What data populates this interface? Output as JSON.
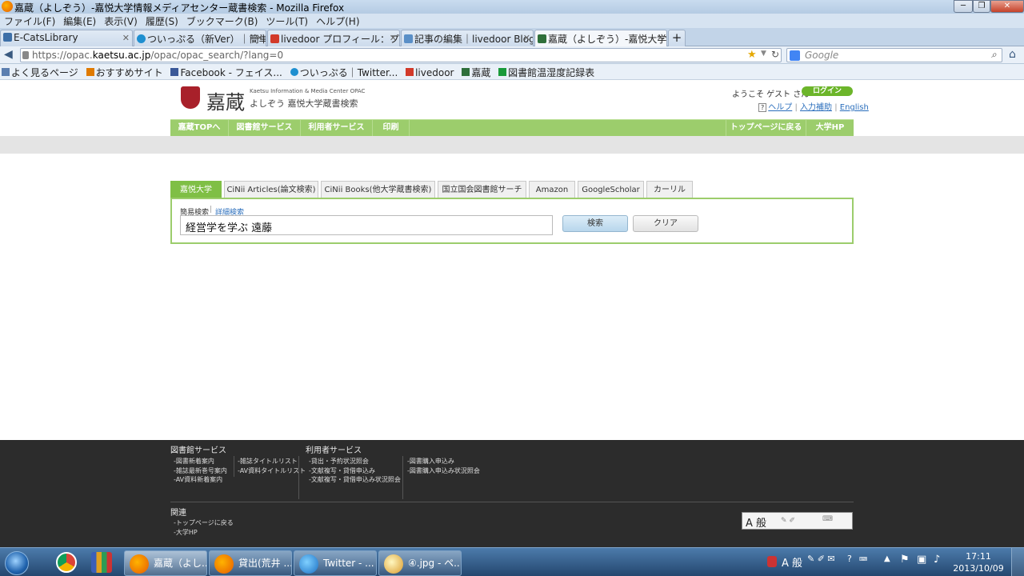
{
  "window": {
    "title": "嘉蔵（よしぞう）-嘉悦大学情報メディアセンター蔵書検索 - Mozilla Firefox",
    "controls": [
      "─",
      "❐",
      "✕"
    ]
  },
  "menu": [
    "ファイル(F)",
    "編集(E)",
    "表示(V)",
    "履歴(S)",
    "ブックマーク(B)",
    "ツール(T)",
    "ヘルプ(H)"
  ],
  "tabs": [
    {
      "label": "E-CatsLibrary"
    },
    {
      "label": "ついっぷる（新Ver）｜簡単..."
    },
    {
      "label": "livedoor プロフィール：プ..."
    },
    {
      "label": "記事の編集｜livedoor Blog"
    },
    {
      "label": "嘉蔵（よしぞう）-嘉悦大学..."
    }
  ],
  "newtab": "+",
  "address": {
    "prefix": "https://opac.",
    "domain": "kaetsu.ac.jp",
    "path": "/opac/opac_search/?lang=0",
    "search_placeholder": "Google"
  },
  "bookmarks": [
    "よく見るページ",
    "おすすめサイト",
    "Facebook - フェイス...",
    "ついっぷる｜Twitter...",
    "livedoor",
    "嘉蔵",
    "図書館温湿度記録表"
  ],
  "header": {
    "logo_main": "嘉蔵",
    "logo_sub_en": "Kaetsu Information & Media Center OPAC",
    "logo_sub_ja": "よしぞう 嘉悦大学蔵書検索",
    "welcome": "ようこそ ゲスト さん",
    "login": "ログイン",
    "help": "ヘルプ",
    "input_help": "入力補助",
    "english": "English",
    "help_q": "?"
  },
  "nav": {
    "left": [
      "嘉蔵TOPへ",
      "図書館サービス",
      "利用者サービス",
      "印刷"
    ],
    "right": [
      "トップページに戻る",
      "大学HP"
    ]
  },
  "search": {
    "tabs": [
      "嘉悦大学",
      "CiNii Articles(論文検索)",
      "CiNii Books(他大学蔵書検索)",
      "国立国会図書館サーチ",
      "Amazon",
      "GoogleScholar",
      "カーリル"
    ],
    "simple_label": "簡易検索",
    "detail_label": "詳細検索",
    "query": "経営学を学ぶ 遠藤",
    "search_button": "検索",
    "clear_button": "クリア"
  },
  "footer": {
    "library_heading": "図書館サービス",
    "library_col1": [
      "-図書新着案内",
      "-雑誌最新巻号案内",
      "-AV資料新着案内"
    ],
    "library_col2": [
      "-雑誌タイトルリスト",
      "-AV資料タイトルリスト"
    ],
    "user_heading": "利用者サービス",
    "user_col1": [
      "-貸出・予約状況照会",
      "-文献複写・貸借申込み",
      "-文献複写・貸借申込み状況照会"
    ],
    "user_col2": [
      "-図書購入申込み",
      "-図書購入申込み状況照会"
    ],
    "related_heading": "関連",
    "related": [
      "-トップページに戻る",
      "-大学HP"
    ],
    "ime": "A 般"
  },
  "taskbar": {
    "buttons": [
      "嘉蔵（よし...",
      "貸出(荒井 ...",
      "Twitter - ...",
      "④.jpg - ペ..."
    ],
    "time": "17:11",
    "date": "2013/10/09",
    "tray_ime": "A 般"
  }
}
